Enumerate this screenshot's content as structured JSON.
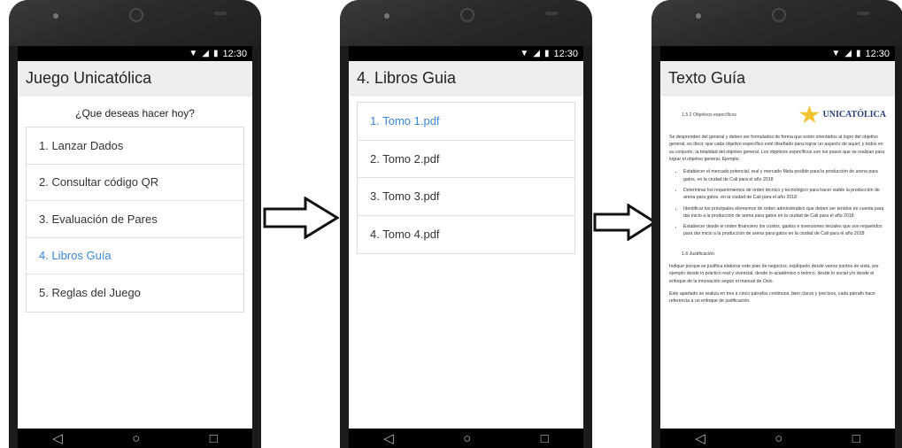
{
  "status": {
    "time": "12:30"
  },
  "screen1": {
    "title": "Juego Unicatólica",
    "prompt": "¿Que deseas hacer hoy?",
    "items": [
      {
        "label": "1. Lanzar Dados"
      },
      {
        "label": "2. Consultar código QR"
      },
      {
        "label": "3. Evaluación de Pares"
      },
      {
        "label": "4. Libros Guía"
      },
      {
        "label": "5. Reglas del Juego"
      }
    ],
    "active_index": 3
  },
  "screen2": {
    "title": "4. Libros Guia",
    "items": [
      {
        "label": "1. Tomo 1.pdf"
      },
      {
        "label": "2. Tomo 2.pdf"
      },
      {
        "label": "3. Tomo 3.pdf"
      },
      {
        "label": "4. Tomo 4.pdf"
      }
    ],
    "active_index": 0
  },
  "screen3": {
    "title": "Texto Guía",
    "logo_text": "UNICATÓLICA",
    "section": "1.5.2 Objetivos específicos",
    "intro": "Se desprenden del general y deben ser formulados de forma que estén orientados al logro del objetivo general, es decir, que cada objetivo específico esté diseñado para lograr un aspecto de aquel; y todos en su conjunto, la totalidad del objetivo general. Los objetivos específicos son los pasos que se realizan para lograr el objetivo general. Ejemplo:",
    "bullets": [
      "Establecer el mercado potencial, real y mercado Meta posible para la producción de arena para gatos, en la ciudad de Cali para el año 2018",
      "Determinar los requerimientos de orden técnico y tecnológico para hacer viable la producción de arena para gatos, en la ciudad de Cali para el año 2018",
      "Identificar los principales elementos de orden administrativo que deben ser tenidos en cuenta para dar inicio a la producción de arena para gatos en la ciudad de Cali para el año 2018",
      "Establecer desde el orden financiero los costos, gastos e inversiones iniciales que son requeridos para dar inicio a la producción de arena para gatos en la ciudad de Cali para el año 2018"
    ],
    "section2": "1.6 Justificación",
    "para2": "Indique porque se justifica elaborar este plan de negocios, explíquelo desde varios puntos de vista, por ejemplo desde lo práctico real y vivencial, desde lo académico o teórico, desde lo social y/o desde el enfoque de la innovación según el manual de Oslo.",
    "para3": "Este apartado se realiza en tres a cinco párrafos continuos, bien claros y precisos, cada párrafo hace referencia a un enfoque de justificación."
  },
  "icons": {
    "wifi": "wifi-icon",
    "signal": "signal-icon",
    "battery": "battery-icon",
    "back": "back-icon",
    "home": "home-icon",
    "recents": "recents-icon",
    "arrow": "right-arrow-icon"
  },
  "colors": {
    "active": "#3a86d9",
    "appbar": "#eeeeee",
    "phone": "#1c1c1c"
  }
}
